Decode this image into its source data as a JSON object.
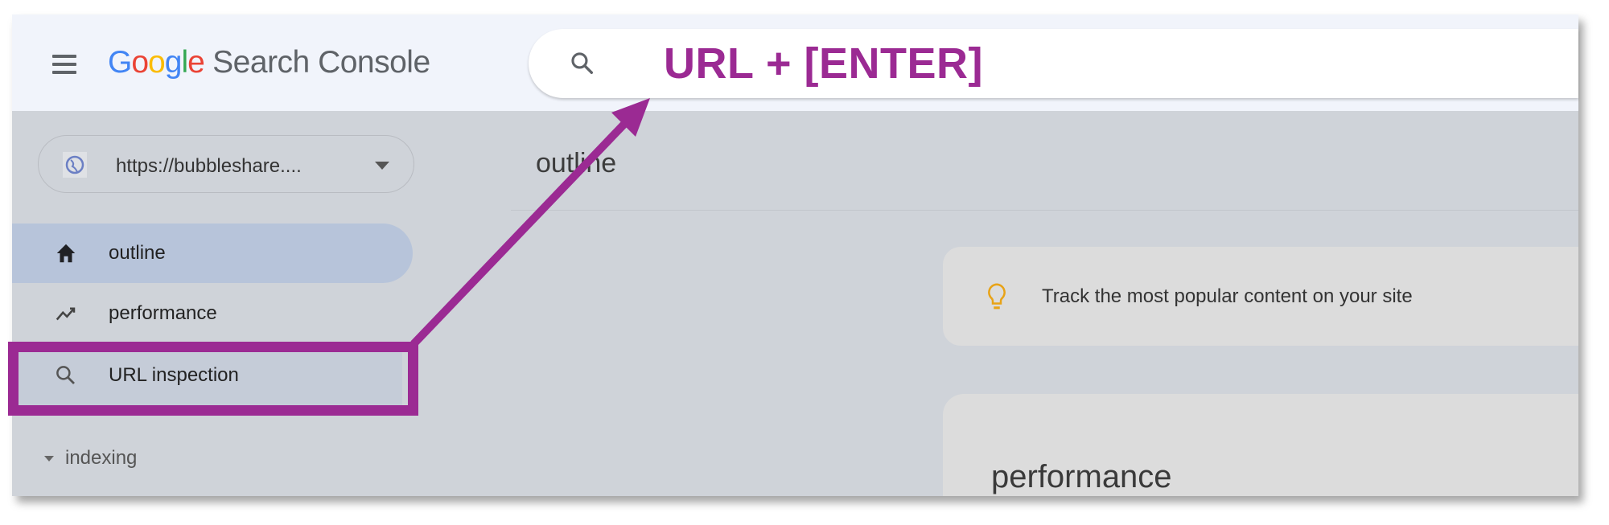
{
  "header": {
    "logo_google": "Google",
    "logo_product": "Search Console",
    "search_overlay_text": "URL + [ENTER]"
  },
  "sidebar": {
    "property": "https://bubbleshare....",
    "items": [
      {
        "label": "outline",
        "icon": "home-icon",
        "selected": true
      },
      {
        "label": "performance",
        "icon": "trending-up-icon",
        "selected": false
      },
      {
        "label": "URL inspection",
        "icon": "search-icon",
        "selected": false,
        "highlighted": true
      }
    ],
    "section": "indexing"
  },
  "main": {
    "title": "outline",
    "tip": "Track the most popular content on your site",
    "card_title": "performance"
  },
  "colors": {
    "annotation": "#9b2a93",
    "selected_nav": "#b7c4da",
    "tip_bulb": "#e8a317"
  }
}
